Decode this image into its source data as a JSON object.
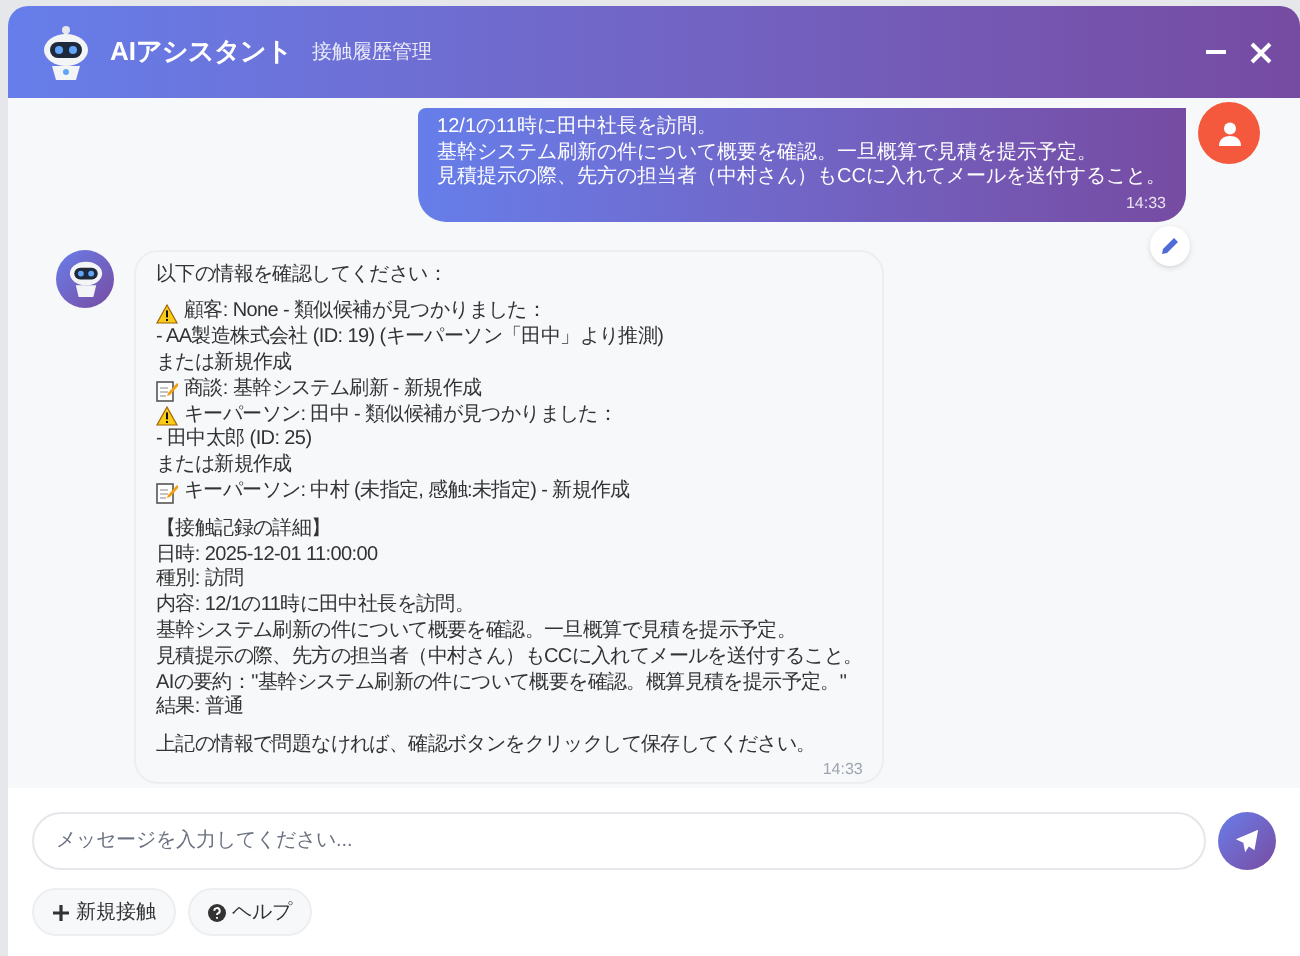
{
  "window": {
    "title": "AIアシスタント",
    "subtitle": "接触履歴管理"
  },
  "messages": [
    {
      "kind": "user",
      "lines": [
        "12/1の11時に田中社長を訪問。",
        "基幹システム刷新の件について概要を確認。一旦概算で見積を提示予定。",
        "見積提示の際、先方の担当者（中村さん）もCCに入れてメールを送付すること。"
      ],
      "time": "14:33"
    },
    {
      "kind": "assistant",
      "lines": [
        {
          "text": "以下の情報を確認してください："
        },
        {
          "kind": "blank"
        },
        {
          "text": "顧客: None - 類似候補が見つかりました：",
          "kind": "warning"
        },
        {
          "text": "- AA製造株式会社 (ID: 19) (キーパーソン「田中」より推測)"
        },
        {
          "text": "または新規作成"
        },
        {
          "text": "商談: 基幹システム刷新 - 新規作成",
          "kind": "memo"
        },
        {
          "text": "キーパーソン: 田中 - 類似候補が見つかりました：",
          "kind": "warning"
        },
        {
          "text": "- 田中太郎 (ID: 25)"
        },
        {
          "text": "または新規作成"
        },
        {
          "text": "キーパーソン: 中村 (未指定, 感触:未指定) - 新規作成",
          "kind": "memo"
        },
        {
          "kind": "blank"
        },
        {
          "text": "【接触記録の詳細】"
        },
        {
          "text": "日時: 2025-12-01 11:00:00"
        },
        {
          "text": "種別: 訪問"
        },
        {
          "text": "内容: 12/1の11時に田中社長を訪問。"
        },
        {
          "text": "基幹システム刷新の件について概要を確認。一旦概算で見積を提示予定。"
        },
        {
          "text": "見積提示の際、先方の担当者（中村さん）もCCに入れてメールを送付すること。"
        },
        {
          "text": "AIの要約：\"基幹システム刷新の件について概要を確認。概算見積を提示予定。\""
        },
        {
          "text": "結果: 普通"
        },
        {
          "kind": "blank"
        },
        {
          "text": "上記の情報で問題なければ、確認ボタンをクリックして保存してください。"
        }
      ],
      "time": "14:33"
    }
  ],
  "input": {
    "placeholder": "メッセージを入力してください..."
  },
  "quick_actions": [
    {
      "label": "新規接触"
    },
    {
      "label": "ヘルプ"
    }
  ]
}
